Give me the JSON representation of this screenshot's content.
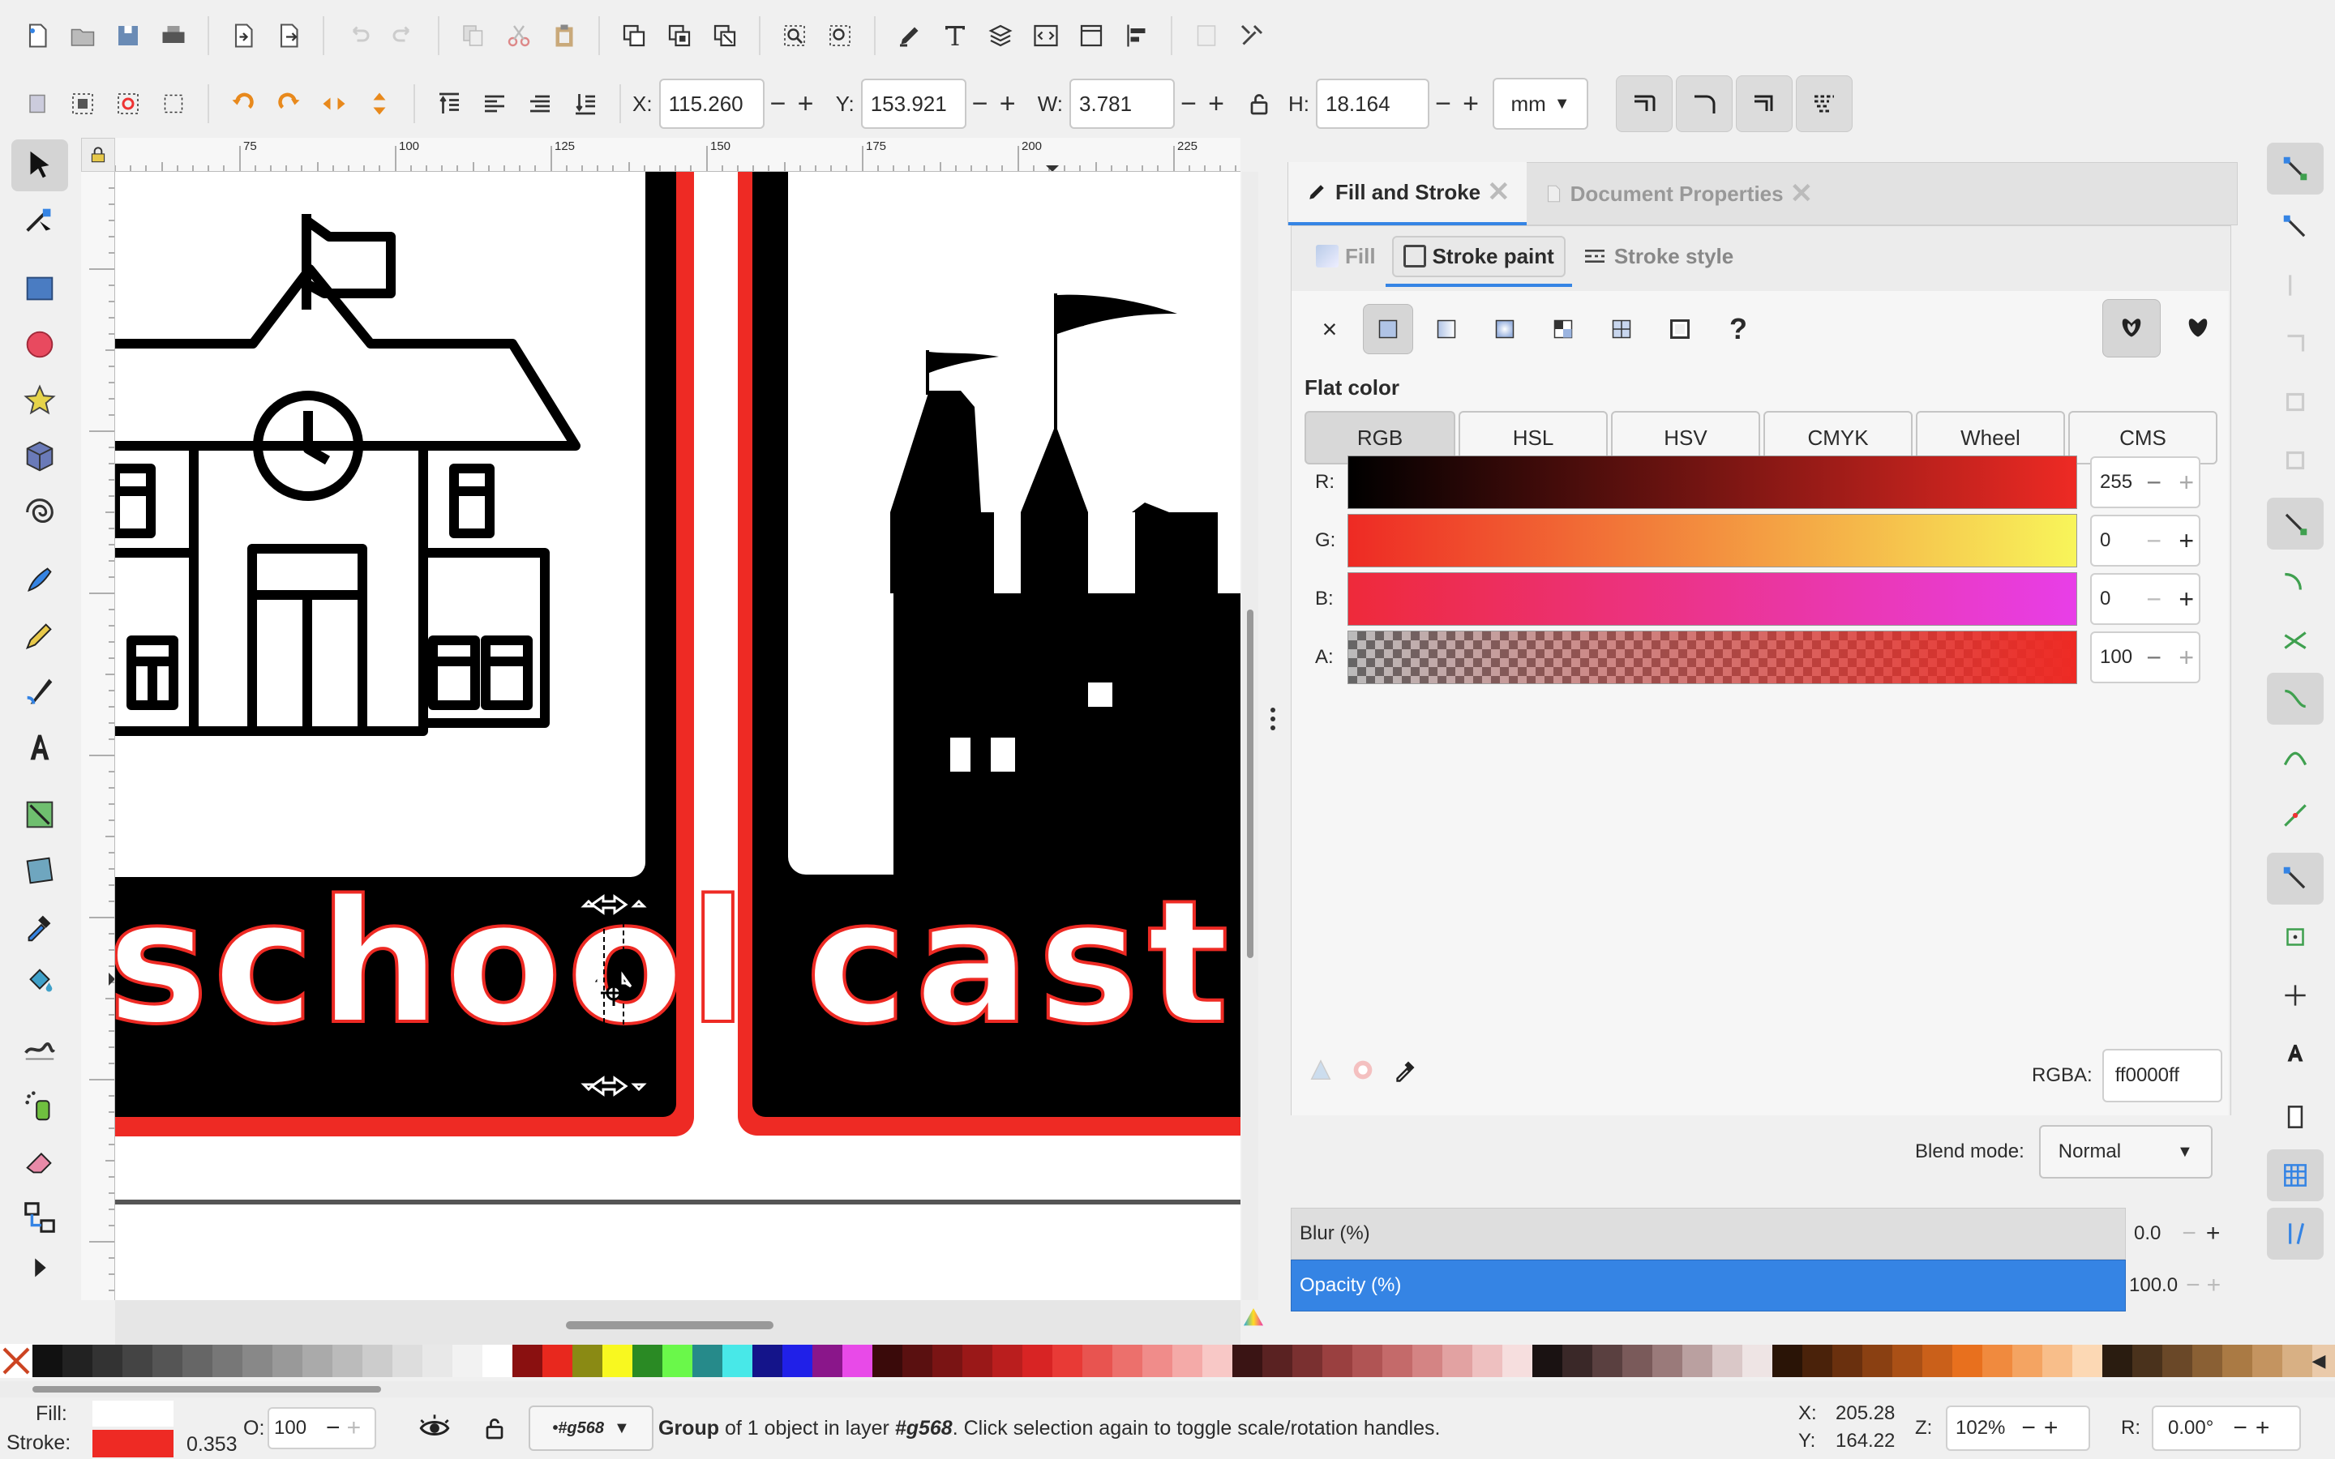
{
  "toolbar": {
    "x_label": "X:",
    "x_value": "115.260",
    "y_label": "Y:",
    "y_value": "153.921",
    "w_label": "W:",
    "w_value": "3.781",
    "h_label": "H:",
    "h_value": "18.164",
    "unit": "mm"
  },
  "ruler": {
    "ticks": [
      "75",
      "100",
      "125",
      "150",
      "175",
      "200",
      "225"
    ]
  },
  "canvas": {
    "word_left": "school",
    "word_right": "cast"
  },
  "panel": {
    "tabs": [
      {
        "label": "Fill and Stroke"
      },
      {
        "label": "Document Properties"
      }
    ],
    "subtabs": [
      {
        "label": "Fill"
      },
      {
        "label": "Stroke paint"
      },
      {
        "label": "Stroke style"
      }
    ],
    "flat_color_label": "Flat color",
    "modes": [
      "RGB",
      "HSL",
      "HSV",
      "CMYK",
      "Wheel",
      "CMS"
    ],
    "channels": [
      {
        "label": "R:",
        "value": "255"
      },
      {
        "label": "G:",
        "value": "0"
      },
      {
        "label": "B:",
        "value": "0"
      },
      {
        "label": "A:",
        "value": "100"
      }
    ],
    "rgba_label": "RGBA:",
    "rgba_value": "ff0000ff",
    "blend_label": "Blend mode:",
    "blend_value": "Normal",
    "blur_label": "Blur (%)",
    "blur_value": "0.0",
    "opacity_label": "Opacity (%)",
    "opacity_value": "100.0",
    "unknown_paint": "?",
    "x_paint": "×"
  },
  "statusbar": {
    "fill_label": "Fill:",
    "stroke_label": "Stroke:",
    "stroke_width": "0.353",
    "o_label": "O:",
    "o_value": "100",
    "layer": "•#g568",
    "message_bold": "Group",
    "message_mid": " of 1 object in layer ",
    "message_layer": "#g568",
    "message_tail": ". Click selection again to toggle scale/rotation handles.",
    "cursor_x_label": "X:",
    "cursor_x": "205.28",
    "cursor_y_label": "Y:",
    "cursor_y": "164.22",
    "zoom_label": "Z:",
    "zoom": "102%",
    "rot_label": "R:",
    "rotation": "0.00°"
  },
  "colors": {
    "accent": "#3584e4",
    "stroke_red": "#ee2a24",
    "selection_blue": "#4a86e8"
  }
}
